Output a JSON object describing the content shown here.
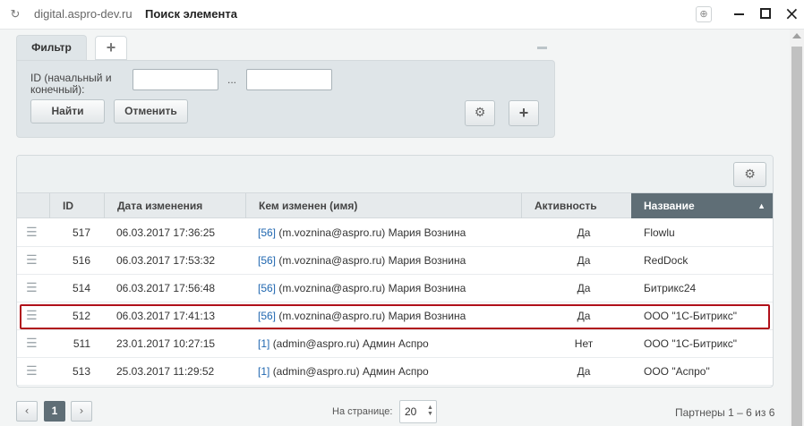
{
  "window": {
    "domain": "digital.aspro-dev.ru",
    "title": "Поиск элемента"
  },
  "filter": {
    "tab_label": "Фильтр",
    "add_tab": "+",
    "id_label": "ID (начальный и конечный):",
    "id_from_value": "",
    "id_to_value": "",
    "range_sep": "...",
    "find_label": "Найти",
    "cancel_label": "Отменить",
    "add_label": "+"
  },
  "grid": {
    "columns": {
      "id": "ID",
      "date": "Дата изменения",
      "user": "Кем изменен (имя)",
      "active": "Активность",
      "name": "Название"
    },
    "sorted_column": "name",
    "rows": [
      {
        "id": "517",
        "date": "06.03.2017 17:36:25",
        "uid": "[56]",
        "user": "(m.voznina@aspro.ru) Мария Вознина",
        "active": "Да",
        "name": "Flowlu"
      },
      {
        "id": "516",
        "date": "06.03.2017 17:53:32",
        "uid": "[56]",
        "user": "(m.voznina@aspro.ru) Мария Вознина",
        "active": "Да",
        "name": "RedDock"
      },
      {
        "id": "514",
        "date": "06.03.2017 17:56:48",
        "uid": "[56]",
        "user": "(m.voznina@aspro.ru) Мария Вознина",
        "active": "Да",
        "name": "Битрикс24"
      },
      {
        "id": "512",
        "date": "06.03.2017 17:41:13",
        "uid": "[56]",
        "user": "(m.voznina@aspro.ru) Мария Вознина",
        "active": "Да",
        "name": "ООО \"1С-Битрикс\""
      },
      {
        "id": "511",
        "date": "23.01.2017 10:27:15",
        "uid": "[1]",
        "user": "(admin@aspro.ru) Админ Аспро",
        "active": "Нет",
        "name": "ООО \"1С-Битрикс\""
      },
      {
        "id": "513",
        "date": "25.03.2017 11:29:52",
        "uid": "[1]",
        "user": "(admin@aspro.ru) Админ Аспро",
        "active": "Да",
        "name": "ООО \"Аспро\""
      }
    ],
    "highlighted_row_id": "512"
  },
  "footer": {
    "prev": "‹",
    "current_page": "1",
    "next": "›",
    "per_page_label": "На странице:",
    "per_page_value": "20",
    "summary": "Партнеры 1 – 6 из 6"
  },
  "colors": {
    "highlight_border": "#b0101a",
    "sorted_header": "#5f6e76",
    "link": "#2067b0"
  }
}
